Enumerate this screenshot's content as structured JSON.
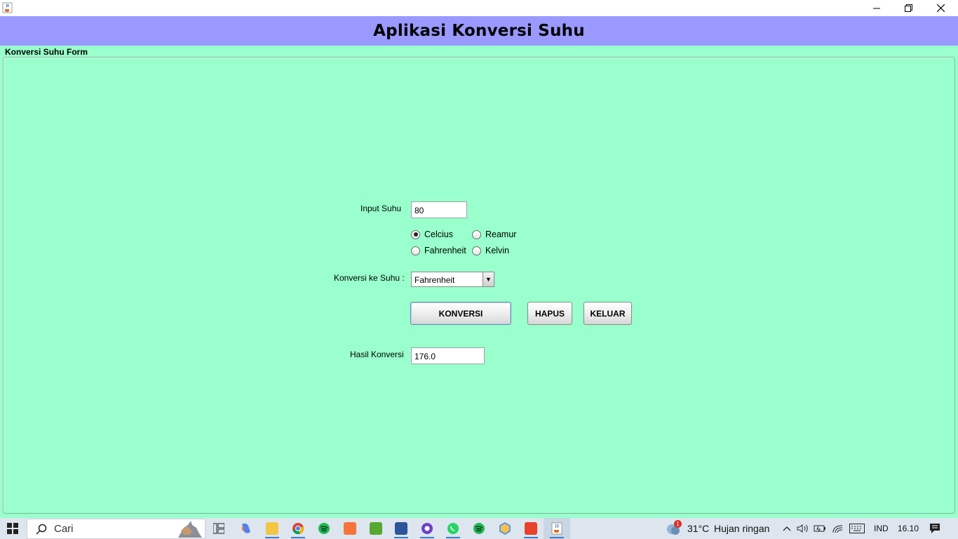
{
  "window": {
    "title_bar_icon": "java-cup-icon"
  },
  "header": {
    "title": "Aplikasi Konversi Suhu"
  },
  "form": {
    "title": "Konversi Suhu Form",
    "input_label": "Input Suhu",
    "input_value": "80",
    "radios": [
      {
        "label": "Celcius",
        "selected": true
      },
      {
        "label": "Reamur",
        "selected": false
      },
      {
        "label": "Fahrenheit",
        "selected": false
      },
      {
        "label": "Kelvin",
        "selected": false
      }
    ],
    "target_label": "Konversi ke Suhu :",
    "target_value": "Fahrenheit",
    "buttons": {
      "convert": "KONVERSI",
      "clear": "HAPUS",
      "exit": "KELUAR"
    },
    "result_label": "Hasil Konversi",
    "result_value": "176.0"
  },
  "taskbar": {
    "search_placeholder": "Cari",
    "weather_temp": "31°C",
    "weather_text": "Hujan ringan",
    "weather_badge": "1",
    "language": "IND",
    "time": "16.10",
    "apps": [
      "task-view-icon",
      "copilot-icon",
      "file-explorer-icon",
      "chrome-icon",
      "spotify-icon",
      "xampp-icon",
      "camtasia-icon",
      "word-icon",
      "github-desktop-icon",
      "whatsapp-icon",
      "spotify-icon",
      "app-icon",
      "office-icon",
      "java-icon"
    ]
  }
}
